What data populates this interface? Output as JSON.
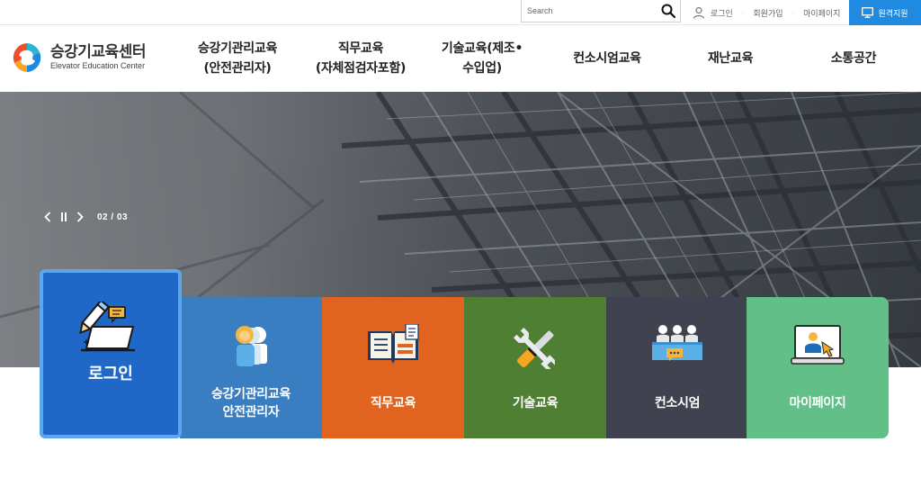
{
  "topbar": {
    "search_placeholder": "Search",
    "links": [
      "로그인",
      "회원가입",
      "마이페이지"
    ],
    "remote_support": "원격지원"
  },
  "logo": {
    "title": "승강기교육센터",
    "subtitle": "Elevator Education Center"
  },
  "nav": [
    {
      "line1": "승강기관리교육",
      "line2": "(안전관리자)"
    },
    {
      "line1": "직무교육",
      "line2": "(자체점검자포함)"
    },
    {
      "line1": "기술교육(제조•",
      "line2": "수입업)"
    },
    {
      "line1": "컨소시엄교육",
      "line2": ""
    },
    {
      "line1": "재난교육",
      "line2": ""
    },
    {
      "line1": "소통공간",
      "line2": ""
    }
  ],
  "slider": {
    "counter": "02 / 03"
  },
  "quick_menu": {
    "login": "로그인",
    "items": [
      {
        "line1": "승강기관리교육",
        "line2": "안전관리자",
        "color": "#3a7ec2",
        "icon": "people-icon"
      },
      {
        "line1": "직무교육",
        "line2": "",
        "color": "#e0641f",
        "icon": "book-icon"
      },
      {
        "line1": "기술교육",
        "line2": "",
        "color": "#4f7f32",
        "icon": "tools-icon"
      },
      {
        "line1": "컨소시엄",
        "line2": "",
        "color": "#41424f",
        "icon": "meeting-icon"
      },
      {
        "line1": "마이페이지",
        "line2": "",
        "color": "#62bf88",
        "icon": "monitor-user-icon"
      }
    ]
  }
}
